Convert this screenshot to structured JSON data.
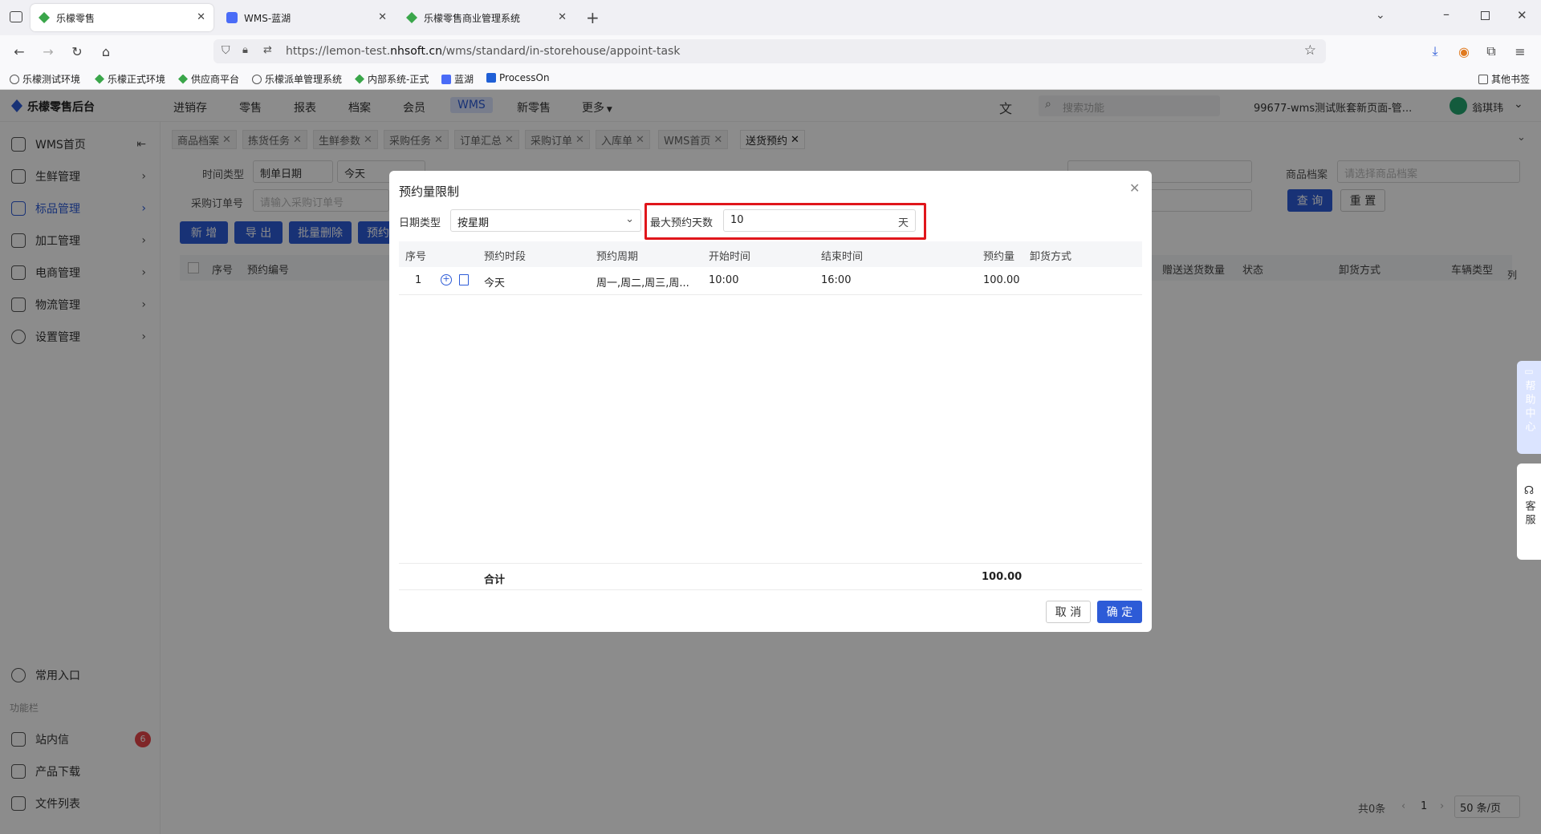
{
  "browser": {
    "tabs": [
      {
        "label": "乐檬零售",
        "active": true
      },
      {
        "label": "WMS-蓝湖",
        "active": false
      },
      {
        "label": "乐檬零售商业管理系统",
        "active": false
      }
    ],
    "url_prefix": "https://lemon-test.",
    "url_domain": "nhsoft.cn",
    "url_path": "/wms/standard/in-storehouse/appoint-task",
    "bookmarks": [
      "乐檬测试环境",
      "乐檬正式环境",
      "供应商平台",
      "乐檬派单管理系统",
      "内部系统-正式",
      "蓝湖",
      "ProcessOn"
    ],
    "other_bookmarks": "其他书签"
  },
  "app": {
    "brand": "乐檬零售后台",
    "nav": [
      "进销存",
      "零售",
      "报表",
      "档案",
      "会员",
      "WMS",
      "新零售",
      "更多"
    ],
    "nav_active": "WMS",
    "search_placeholder": "搜索功能",
    "account": "99677-wms测试账套新页面-管...",
    "user": "翁琪玮"
  },
  "sidebar": {
    "items": [
      {
        "label": "WMS首页"
      },
      {
        "label": "生鲜管理"
      },
      {
        "label": "标品管理"
      },
      {
        "label": "加工管理"
      },
      {
        "label": "电商管理"
      },
      {
        "label": "物流管理"
      },
      {
        "label": "设置管理"
      }
    ],
    "favorites": "常用入口",
    "section": "功能栏",
    "inbox": "站内信",
    "inbox_count": "6",
    "download": "产品下载",
    "files": "文件列表"
  },
  "page": {
    "tabs": [
      "商品档案",
      "拣货任务",
      "生鲜参数",
      "采购任务",
      "订单汇总",
      "采购订单",
      "入库单",
      "WMS首页",
      "送货预约"
    ],
    "filters": {
      "time_type_label": "时间类型",
      "time_type_value": "制单日期",
      "date_value": "今天",
      "po_label": "采购订单号",
      "po_placeholder": "请输入采购订单号",
      "goods_label": "商品档案",
      "goods_placeholder": "请选择商品档案"
    },
    "buttons": {
      "add": "新 增",
      "export": "导 出",
      "batch_delete": "批量删除",
      "appoint": "预约",
      "query": "查 询",
      "reset": "重 置"
    },
    "columns": [
      "序号",
      "预约编号",
      "赠送送货数量",
      "状态",
      "卸货方式",
      "车辆类型"
    ],
    "col_setting": "列",
    "total_text": "共0条",
    "page_num": "1",
    "page_size": "50 条/页"
  },
  "modal": {
    "title": "预约量限制",
    "date_type_label": "日期类型",
    "date_type_value": "按星期",
    "max_days_label": "最大预约天数",
    "max_days_value": "10",
    "max_days_unit": "天",
    "columns": [
      "序号",
      "预约时段",
      "预约周期",
      "开始时间",
      "结束时间",
      "预约量",
      "卸货方式"
    ],
    "rows": [
      {
        "index": "1",
        "period": "今天",
        "cycle": "周一,周二,周三,周...",
        "start": "10:00",
        "end": "16:00",
        "qty": "100.00",
        "unload": ""
      }
    ],
    "total_label": "合计",
    "total_qty": "100.00",
    "cancel": "取 消",
    "ok": "确 定"
  },
  "help": {
    "center": "帮助中心",
    "service": "客服"
  }
}
